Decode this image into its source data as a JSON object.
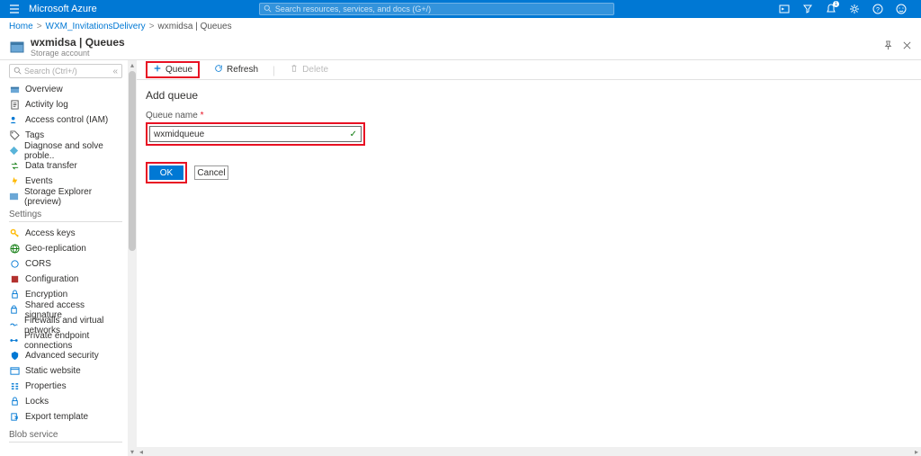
{
  "topbar": {
    "brand": "Microsoft Azure",
    "search_placeholder": "Search resources, services, and docs (G+/)",
    "notification_count": "1"
  },
  "breadcrumb": {
    "home": "Home",
    "level1": "WXM_InvitationsDelivery",
    "level2": "wxmidsa | Queues"
  },
  "resource": {
    "title": "wxmidsa | Queues",
    "subtitle": "Storage account"
  },
  "sidesearch": {
    "placeholder": "Search (Ctrl+/)"
  },
  "nav": {
    "overview": "Overview",
    "activity": "Activity log",
    "iam": "Access control (IAM)",
    "tags": "Tags",
    "diagnose": "Diagnose and solve proble..",
    "datatransfer": "Data transfer",
    "events": "Events",
    "explorer": "Storage Explorer (preview)",
    "settings_group": "Settings",
    "accesskeys": "Access keys",
    "geo": "Geo-replication",
    "cors": "CORS",
    "config": "Configuration",
    "encryption": "Encryption",
    "sas": "Shared access signature",
    "firewall": "Firewalls and virtual networks",
    "endpoint": "Private endpoint connections",
    "security": "Advanced security",
    "static": "Static website",
    "properties": "Properties",
    "locks": "Locks",
    "export": "Export template",
    "blob_group": "Blob service"
  },
  "toolbar": {
    "queue": "Queue",
    "refresh": "Refresh",
    "delete": "Delete"
  },
  "form": {
    "title": "Add queue",
    "label": "Queue name",
    "value": "wxmidqueue",
    "ok": "OK",
    "cancel": "Cancel"
  }
}
